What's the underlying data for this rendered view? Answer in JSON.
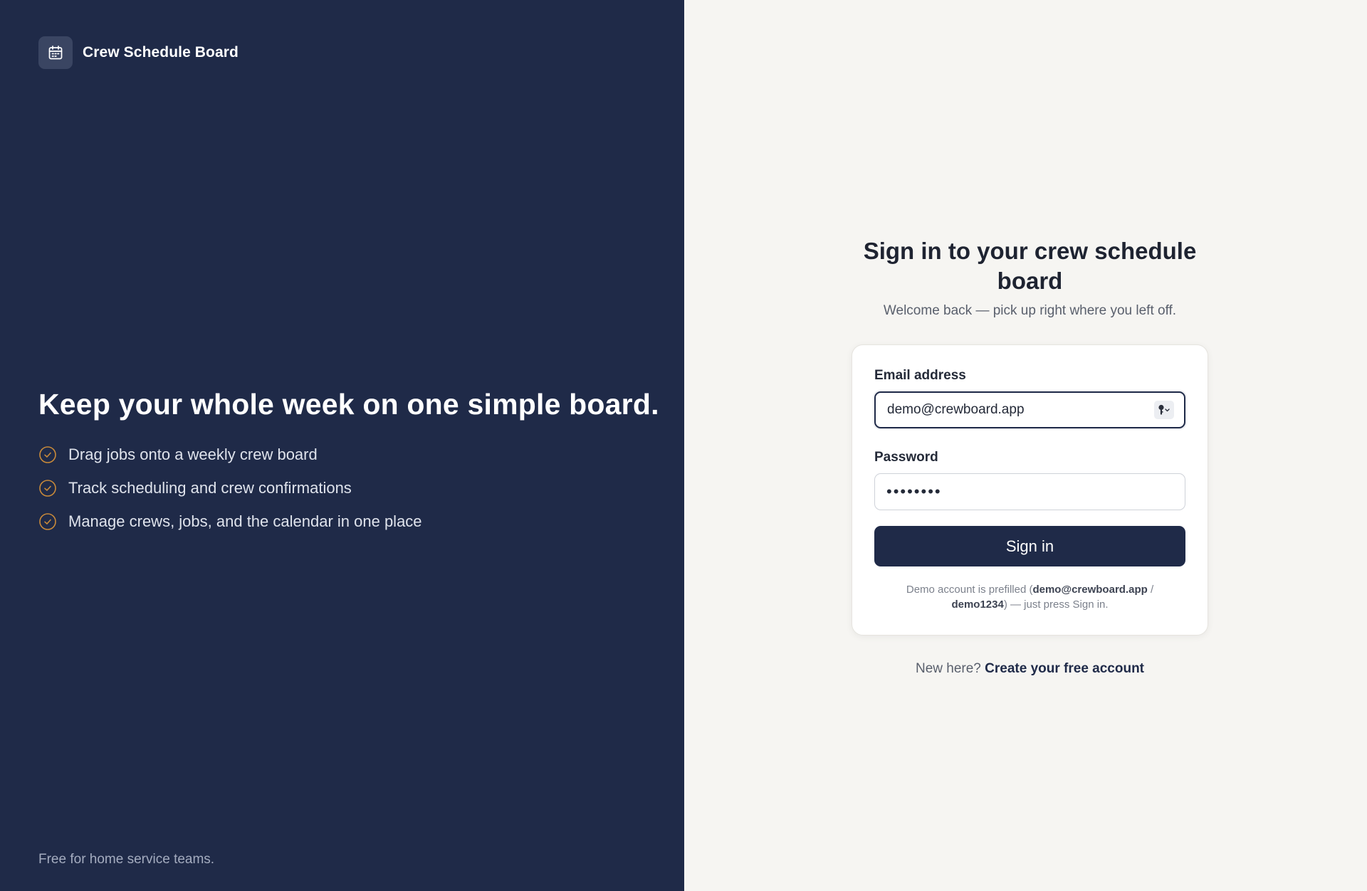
{
  "brand": {
    "name": "Crew Schedule Board",
    "icon": "calendar-icon"
  },
  "hero": {
    "title": "Keep your whole week on one simple board.",
    "features": [
      "Drag jobs onto a weekly crew board",
      "Track scheduling and crew confirmations",
      "Manage crews, jobs, and the calendar in one place"
    ]
  },
  "footer": {
    "text": "Free for home service teams."
  },
  "signin": {
    "title": "Sign in to your crew schedule board",
    "subtitle": "Welcome back — pick up right where you left off.",
    "email_label": "Email address",
    "email_value": "demo@crewboard.app",
    "password_label": "Password",
    "password_value": "demo1234",
    "submit_label": "Sign in",
    "demo_note_prefix": "Demo account is prefilled (",
    "demo_email": "demo@crewboard.app",
    "demo_sep": " / ",
    "demo_password": "demo1234",
    "demo_note_suffix": ") — just press Sign in."
  },
  "signup": {
    "prompt": "New here?",
    "link_label": "Create your free account"
  },
  "colors": {
    "navy": "#1f2a48",
    "accent_check": "#c98a3a",
    "page_bg": "#f6f5f2"
  }
}
